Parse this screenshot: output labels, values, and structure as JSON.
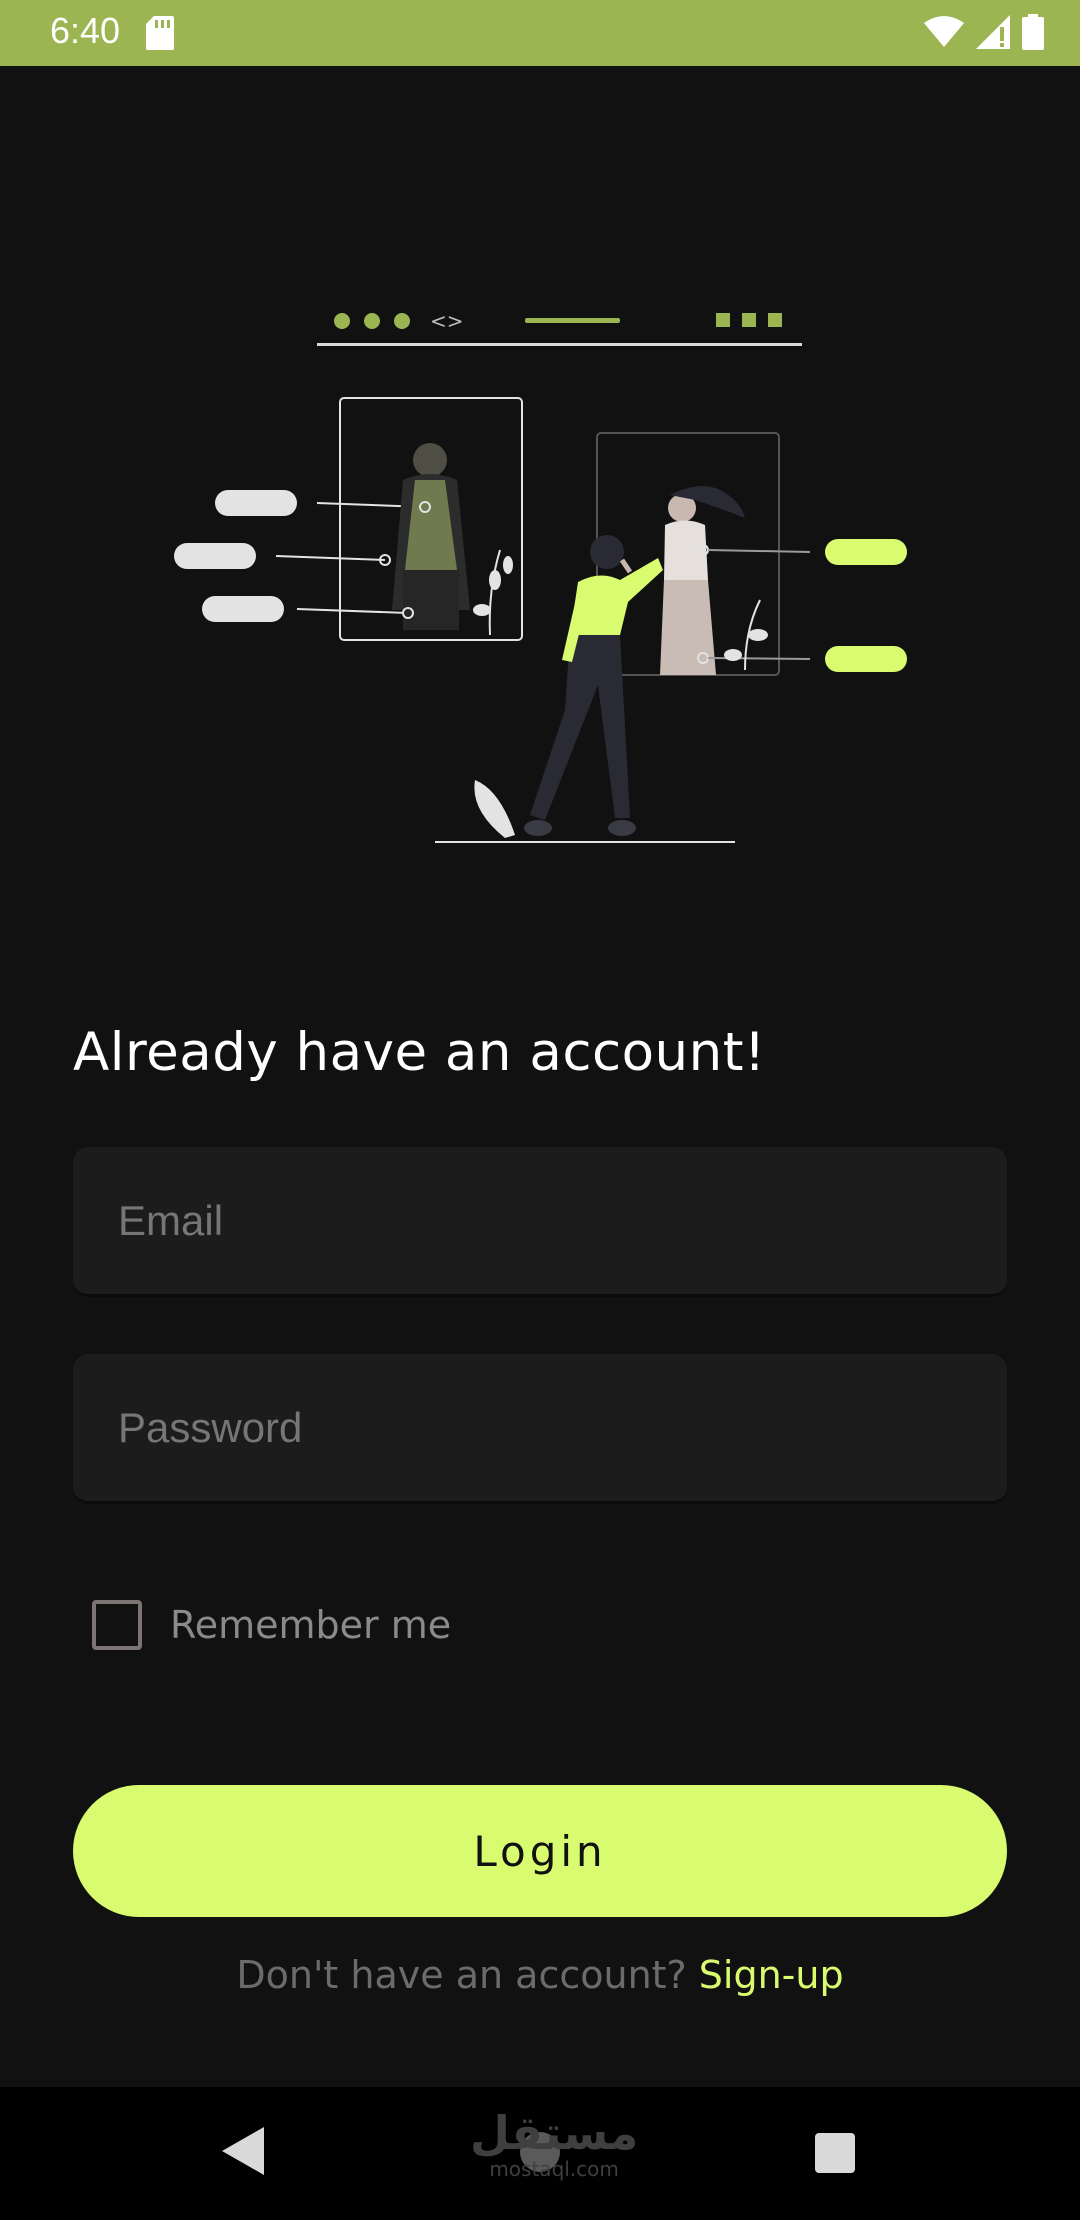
{
  "status_bar": {
    "time": "6:40",
    "icons": [
      "sd-card-icon",
      "wifi-icon",
      "signal-icon",
      "battery-icon"
    ]
  },
  "illustration": {
    "name": "login-illustration",
    "code_glyph": "<>"
  },
  "headline": "Already have an account!",
  "form": {
    "email_placeholder": "Email",
    "password_placeholder": "Password",
    "remember_label": "Remember me",
    "login_label": "Login"
  },
  "signup": {
    "prompt": "Don't have an account? ",
    "link": "Sign-up"
  },
  "watermark": {
    "arabic": "مستقل",
    "latin": "mostaql.com"
  },
  "colors": {
    "accent": "#d9fb6f",
    "status_bar": "#9bb552",
    "background": "#111111",
    "field": "#1c1c1c"
  }
}
